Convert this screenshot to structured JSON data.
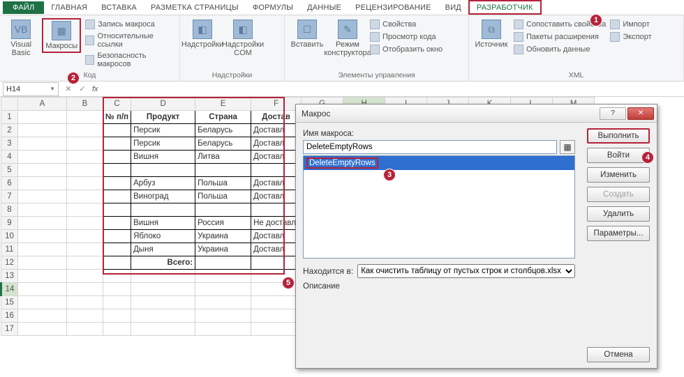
{
  "tabs": {
    "file": "ФАЙЛ",
    "home": "ГЛАВНАЯ",
    "insert": "ВСТАВКА",
    "layout": "РАЗМЕТКА СТРАНИЦЫ",
    "formulas": "ФОРМУЛЫ",
    "data": "ДАННЫЕ",
    "review": "РЕЦЕНЗИРОВАНИЕ",
    "view": "ВИД",
    "dev": "РАЗРАБОТЧИК"
  },
  "ribbon": {
    "g1": {
      "title": "Код",
      "vb": "Visual\nBasic",
      "macros": "Макросы",
      "rec": "Запись макроса",
      "rel": "Относительные ссылки",
      "sec": "Безопасность макросов"
    },
    "g2": {
      "title": "Надстройки",
      "addin": "Надстройки",
      "com": "Надстройки COM"
    },
    "g3": {
      "title": "Элементы управления",
      "insert": "Вставить",
      "design": "Режим конструктора",
      "props": "Свойства",
      "code": "Просмотр кода",
      "show": "Отобразить окно"
    },
    "g4": {
      "title": "XML",
      "source": "Источник",
      "map": "Сопоставить свойства",
      "ext": "Пакеты расширения",
      "refresh": "Обновить данные",
      "import": "Импорт",
      "export": "Экспорт"
    }
  },
  "namebox": "H14",
  "cols": [
    "A",
    "B",
    "C",
    "D",
    "E",
    "F",
    "G",
    "H",
    "I",
    "J",
    "K",
    "L",
    "M"
  ],
  "rows": [
    "1",
    "2",
    "3",
    "4",
    "5",
    "6",
    "7",
    "8",
    "9",
    "10",
    "11",
    "12",
    "13",
    "14",
    "15",
    "16",
    "17"
  ],
  "table": {
    "h": [
      "№ п/п",
      "Продукт",
      "Страна",
      "Достав"
    ],
    "r": [
      [
        "",
        "Персик",
        "Беларусь",
        "Доставл"
      ],
      [
        "",
        "Персик",
        "Беларусь",
        "Доставл"
      ],
      [
        "",
        "Вишня",
        "Литва",
        "Доставл"
      ],
      [
        "",
        "",
        "",
        ""
      ],
      [
        "",
        "Арбуз",
        "Польша",
        "Доставл"
      ],
      [
        "",
        "Виноград",
        "Польша",
        "Доставл"
      ],
      [
        "",
        "",
        "",
        ""
      ],
      [
        "",
        "Вишня",
        "Россия",
        "Не доставл"
      ],
      [
        "",
        "Яблоко",
        "Украина",
        "Доставл"
      ],
      [
        "",
        "Дыня",
        "Украина",
        "Доставл"
      ]
    ],
    "total": "Всего:"
  },
  "dialog": {
    "title": "Макрос",
    "name_label": "Имя макроса:",
    "name_value": "DeleteEmptyRows",
    "list": [
      "DeleteEmptyRows"
    ],
    "loc_label": "Находится в:",
    "loc_value": "Как очистить таблицу от пустых строк и столбцов.xlsx",
    "desc_label": "Описание",
    "btn_run": "Выполнить",
    "btn_step": "Войти",
    "btn_edit": "Изменить",
    "btn_new": "Создать",
    "btn_del": "Удалить",
    "btn_opt": "Параметры...",
    "btn_cancel": "Отмена"
  },
  "callouts": {
    "1": "1",
    "2": "2",
    "3": "3",
    "4": "4",
    "5": "5"
  }
}
